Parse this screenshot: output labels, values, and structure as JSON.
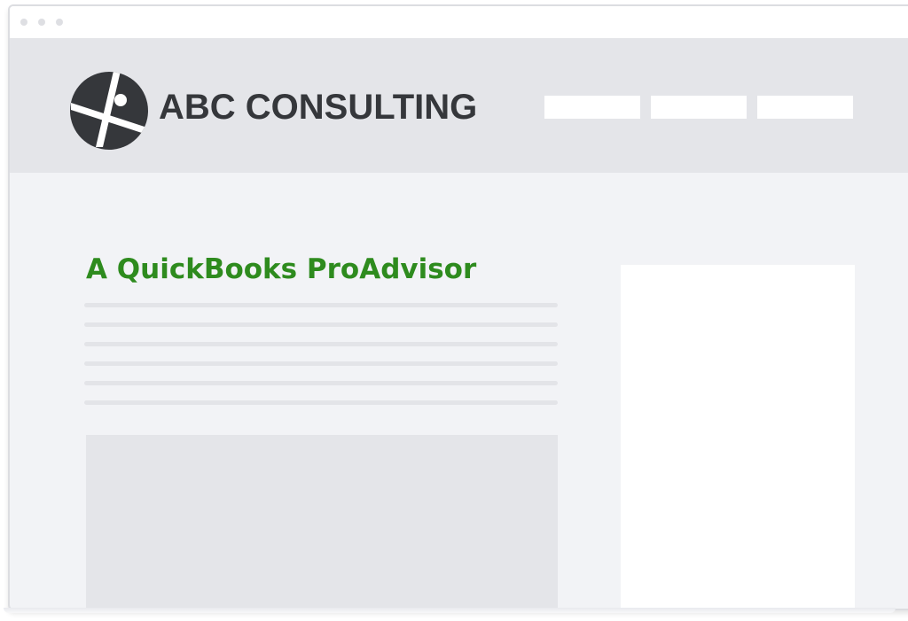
{
  "header": {
    "brand_name": "ABC CONSULTING",
    "logo_icon": "abc-consulting-logo-icon",
    "nav_items": [
      "",
      "",
      ""
    ]
  },
  "main": {
    "headline": "A QuickBooks ProAdvisor",
    "text_placeholder_lines": 6
  },
  "colors": {
    "accent_green": "#2e8b1e",
    "header_bg": "#e4e5e9",
    "page_bg": "#f2f3f6",
    "brand_text": "#35373b"
  }
}
